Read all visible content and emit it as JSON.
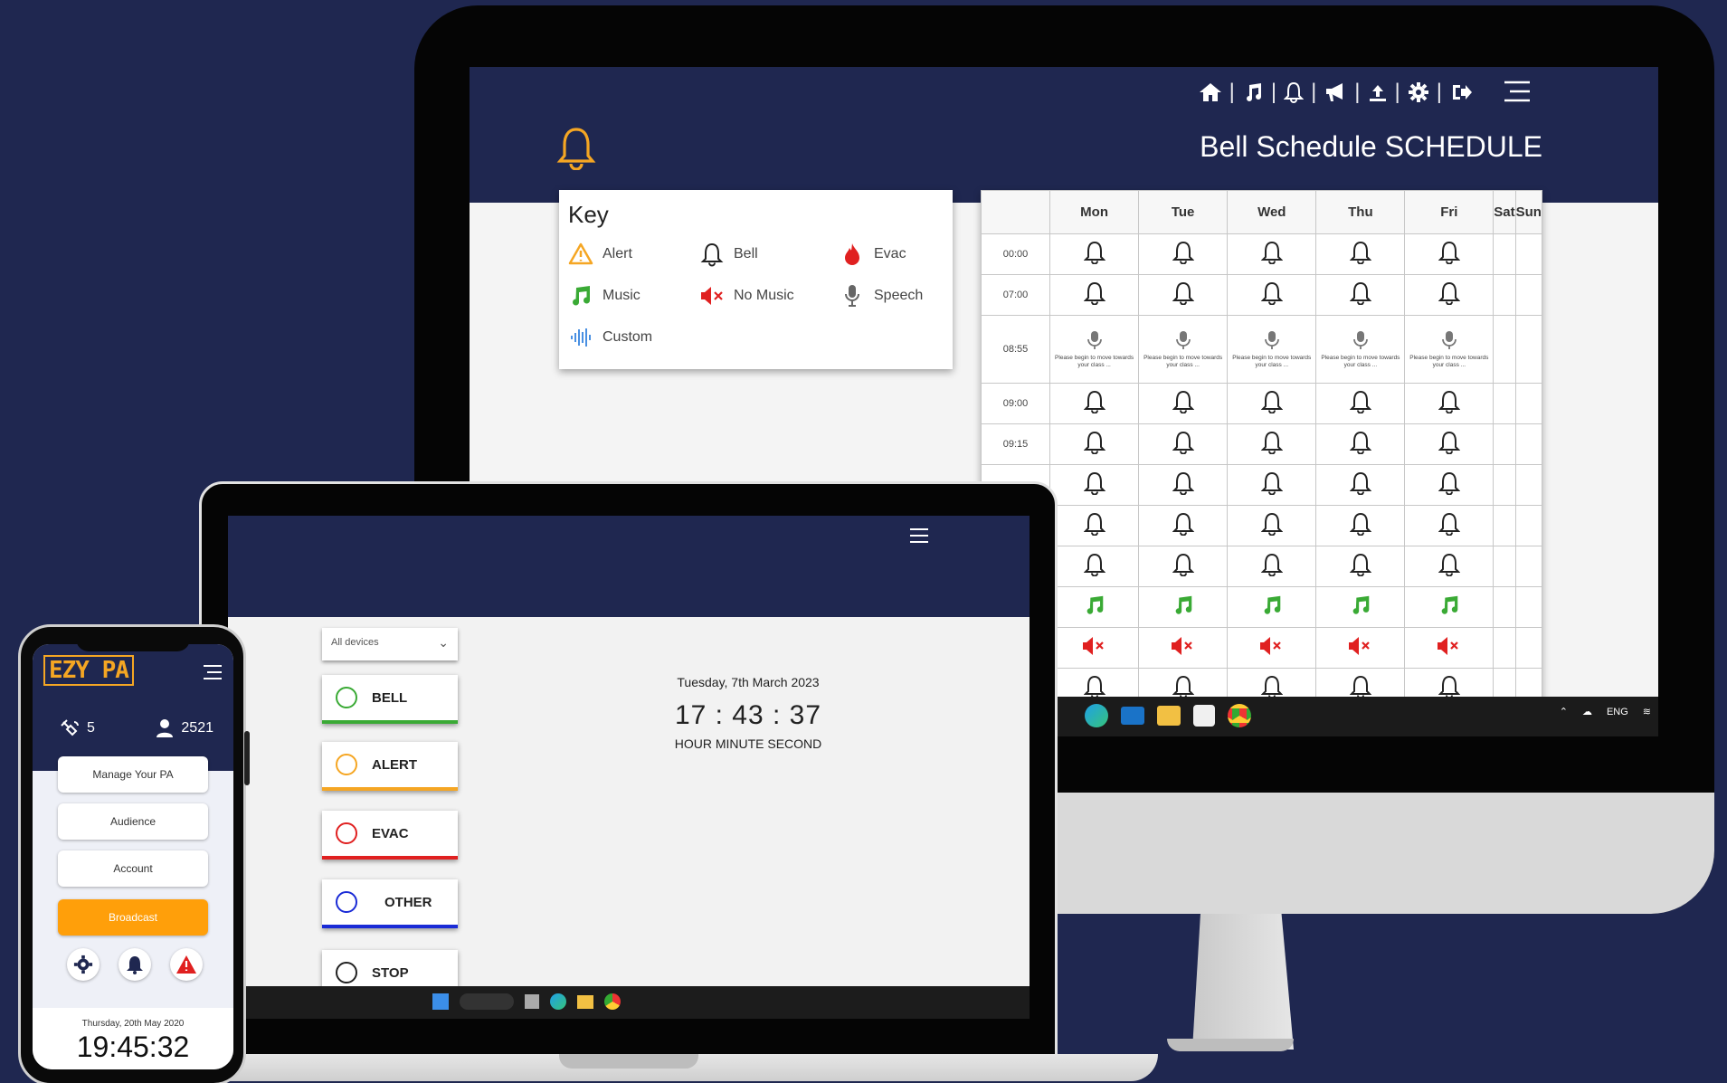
{
  "colors": {
    "navy": "#1f2750",
    "orange": "#f5a623",
    "green": "#3aaa35",
    "red": "#e02020",
    "blue": "#1a2bd6"
  },
  "monitor": {
    "title": "Bell Schedule SCHEDULE",
    "nav_icons": [
      "home-icon",
      "music-icon",
      "bell-icon",
      "megaphone-icon",
      "upload-icon",
      "gear-icon",
      "logout-icon"
    ],
    "key": {
      "heading": "Key",
      "items": [
        {
          "icon": "alert-icon",
          "label": "Alert"
        },
        {
          "icon": "bell-icon",
          "label": "Bell"
        },
        {
          "icon": "evac-flame-icon",
          "label": "Evac"
        },
        {
          "icon": "music-icon",
          "label": "Music"
        },
        {
          "icon": "no-music-icon",
          "label": "No Music"
        },
        {
          "icon": "speech-mic-icon",
          "label": "Speech"
        },
        {
          "icon": "custom-wave-icon",
          "label": "Custom"
        }
      ]
    },
    "schedule": {
      "days": [
        "Mon",
        "Tue",
        "Wed",
        "Thu",
        "Fri",
        "Sat",
        "Sun"
      ],
      "rows": [
        {
          "time": "00:00",
          "type": "bell"
        },
        {
          "time": "07:00",
          "type": "bell"
        },
        {
          "time": "08:55",
          "type": "speech"
        },
        {
          "time": "09:00",
          "type": "bell"
        },
        {
          "time": "09:15",
          "type": "bell"
        },
        {
          "time": "",
          "type": "bell"
        },
        {
          "time": "",
          "type": "bell"
        },
        {
          "time": "",
          "type": "bell"
        },
        {
          "time": "",
          "type": "music"
        },
        {
          "time": "",
          "type": "nomusic"
        },
        {
          "time": "",
          "type": "bell"
        }
      ],
      "speech_text": "Please begin to move towards your class ..."
    }
  },
  "laptop": {
    "device_select": "All devices",
    "buttons": [
      {
        "label": "BELL",
        "color": "#3aaa35"
      },
      {
        "label": "ALERT",
        "color": "#f5a623"
      },
      {
        "label": "EVAC",
        "color": "#e02020"
      },
      {
        "label": "OTHER",
        "color": "#1a2bd6"
      },
      {
        "label": "STOP",
        "color": "#222222"
      }
    ],
    "clock": {
      "date": "Tuesday, 7th March 2023",
      "time": "17 : 43 : 37",
      "labels": "HOUR  MINUTE  SECOND"
    }
  },
  "phone": {
    "logo": "EZY PA",
    "devices_count": "5",
    "users_count": "2521",
    "buttons": [
      "Manage Your PA",
      "Audience",
      "Account",
      "Broadcast"
    ],
    "footer_date": "Thursday, 20th May 2020",
    "footer_time": "19:45:32"
  }
}
